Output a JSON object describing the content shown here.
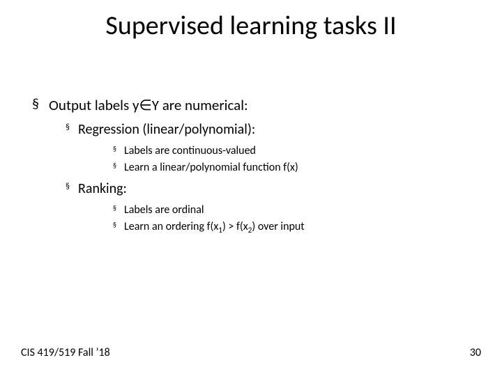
{
  "title": "Supervised learning tasks II",
  "bullets": {
    "main": "Output labels y∈Y are numerical:",
    "regression": {
      "heading": "Regression (linear/polynomial):",
      "p1": "Labels are continuous-valued",
      "p2": "Learn a linear/polynomial function f(x)"
    },
    "ranking": {
      "heading": "Ranking:",
      "p1": "Labels are ordinal",
      "p2_pre": "Learn an ordering f(x",
      "p2_s1": "1",
      "p2_mid": ") > f(x",
      "p2_s2": "2",
      "p2_post": ") over input"
    }
  },
  "footer": {
    "left": "CIS 419/519 Fall ’18",
    "right": "30"
  }
}
